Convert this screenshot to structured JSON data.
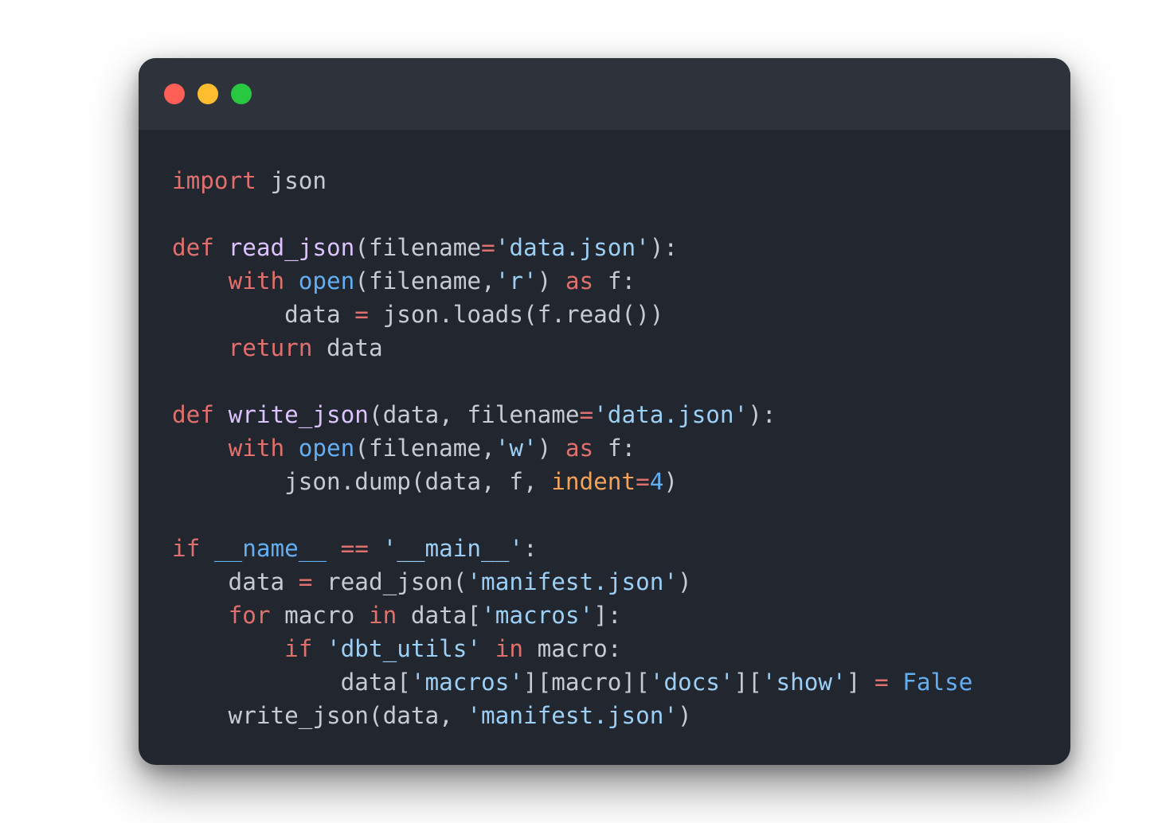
{
  "window": {
    "background": "#22262e",
    "titlebar_background": "#2e323b",
    "controls": [
      {
        "name": "close-button",
        "color": "#fe5f57"
      },
      {
        "name": "minimize-button",
        "color": "#febc2e"
      },
      {
        "name": "zoom-button",
        "color": "#28c840"
      }
    ]
  },
  "code": {
    "language": "python",
    "colors": {
      "keyword": "#e0706d",
      "function_name": "#dcc3ff",
      "builtin": "#63aef2",
      "string": "#9ccff5",
      "operator": "#e0706d",
      "kwarg": "#f4a25a",
      "number": "#63aef2",
      "plain": "#c6cbd3"
    },
    "lines": [
      [
        [
          "keyword",
          "import"
        ],
        [
          "plain",
          " json"
        ]
      ],
      [],
      [
        [
          "keyword",
          "def"
        ],
        [
          "plain",
          " "
        ],
        [
          "function_name",
          "read_json"
        ],
        [
          "plain",
          "(filename"
        ],
        [
          "operator",
          "="
        ],
        [
          "string",
          "'data.json'"
        ],
        [
          "plain",
          "):"
        ]
      ],
      [
        [
          "plain",
          "    "
        ],
        [
          "keyword",
          "with"
        ],
        [
          "plain",
          " "
        ],
        [
          "builtin",
          "open"
        ],
        [
          "plain",
          "(filename,"
        ],
        [
          "string",
          "'r'"
        ],
        [
          "plain",
          ") "
        ],
        [
          "keyword",
          "as"
        ],
        [
          "plain",
          " f:"
        ]
      ],
      [
        [
          "plain",
          "        data "
        ],
        [
          "operator",
          "="
        ],
        [
          "plain",
          " json.loads(f.read())"
        ]
      ],
      [
        [
          "plain",
          "    "
        ],
        [
          "keyword",
          "return"
        ],
        [
          "plain",
          " data"
        ]
      ],
      [],
      [
        [
          "keyword",
          "def"
        ],
        [
          "plain",
          " "
        ],
        [
          "function_name",
          "write_json"
        ],
        [
          "plain",
          "(data, filename"
        ],
        [
          "operator",
          "="
        ],
        [
          "string",
          "'data.json'"
        ],
        [
          "plain",
          "):"
        ]
      ],
      [
        [
          "plain",
          "    "
        ],
        [
          "keyword",
          "with"
        ],
        [
          "plain",
          " "
        ],
        [
          "builtin",
          "open"
        ],
        [
          "plain",
          "(filename,"
        ],
        [
          "string",
          "'w'"
        ],
        [
          "plain",
          ") "
        ],
        [
          "keyword",
          "as"
        ],
        [
          "plain",
          " f:"
        ]
      ],
      [
        [
          "plain",
          "        json.dump(data, f, "
        ],
        [
          "kwarg",
          "indent"
        ],
        [
          "operator",
          "="
        ],
        [
          "number",
          "4"
        ],
        [
          "plain",
          ")"
        ]
      ],
      [],
      [
        [
          "keyword",
          "if"
        ],
        [
          "plain",
          " "
        ],
        [
          "builtin",
          "__name__"
        ],
        [
          "plain",
          " "
        ],
        [
          "operator",
          "=="
        ],
        [
          "plain",
          " "
        ],
        [
          "string",
          "'__main__'"
        ],
        [
          "plain",
          ":"
        ]
      ],
      [
        [
          "plain",
          "    data "
        ],
        [
          "operator",
          "="
        ],
        [
          "plain",
          " read_json("
        ],
        [
          "string",
          "'manifest.json'"
        ],
        [
          "plain",
          ")"
        ]
      ],
      [
        [
          "plain",
          "    "
        ],
        [
          "keyword",
          "for"
        ],
        [
          "plain",
          " macro "
        ],
        [
          "keyword",
          "in"
        ],
        [
          "plain",
          " data["
        ],
        [
          "string",
          "'macros'"
        ],
        [
          "plain",
          "]:"
        ]
      ],
      [
        [
          "plain",
          "        "
        ],
        [
          "keyword",
          "if"
        ],
        [
          "plain",
          " "
        ],
        [
          "string",
          "'dbt_utils'"
        ],
        [
          "plain",
          " "
        ],
        [
          "keyword",
          "in"
        ],
        [
          "plain",
          " macro:"
        ]
      ],
      [
        [
          "plain",
          "            data["
        ],
        [
          "string",
          "'macros'"
        ],
        [
          "plain",
          "][macro]["
        ],
        [
          "string",
          "'docs'"
        ],
        [
          "plain",
          "]["
        ],
        [
          "string",
          "'show'"
        ],
        [
          "plain",
          "] "
        ],
        [
          "operator",
          "="
        ],
        [
          "plain",
          " "
        ],
        [
          "builtin",
          "False"
        ]
      ],
      [
        [
          "plain",
          "    write_json(data, "
        ],
        [
          "string",
          "'manifest.json'"
        ],
        [
          "plain",
          ")"
        ]
      ]
    ]
  }
}
